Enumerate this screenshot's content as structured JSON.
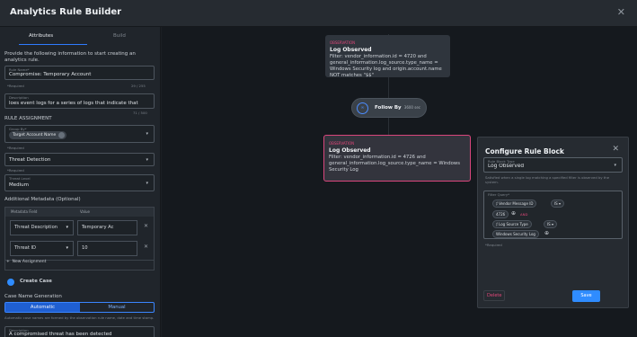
{
  "window": {
    "title": "Analytics Rule Builder"
  },
  "tabs": [
    "Attributes",
    "Build"
  ],
  "intro": "Provide the following information to start creating an analytics rule.",
  "rule_name": {
    "label": "Rule Name*",
    "value": "Compromise: Temporary Account",
    "help": "*Required",
    "count": "29 / 255"
  },
  "description": {
    "label": "Description",
    "value": "loes event logs for a series of logs that indicate that",
    "count": "71 / 500"
  },
  "rule_assignment": {
    "heading": "RULE ASSIGNMENT",
    "group_by": {
      "label": "Group By*",
      "chip": "Target Account Name",
      "help": "*Required"
    },
    "category": {
      "value": "Threat Detection",
      "help": "*Required"
    },
    "threat_level": {
      "label": "Threat Level",
      "value": "Medium"
    }
  },
  "metadata": {
    "heading": "Additional Metadata (Optional)",
    "columns": [
      "Metadata Field",
      "Value"
    ],
    "rows": [
      {
        "field": "Threat Description",
        "value": "Temporary Ac"
      },
      {
        "field": "Threat ID",
        "value": "10"
      }
    ],
    "new_label": "New Assignment"
  },
  "create_case": "Create Case",
  "case_name": {
    "heading": "Case Name Generation",
    "options": [
      "Automatic",
      "Manual"
    ],
    "selected": "Automatic",
    "help": "Automatic case names are formed by the observation rule name, date and time stamp.",
    "desc_label": "Description",
    "desc_value": "A compromised threat has been detected"
  },
  "canvas": {
    "node1": {
      "type": "OBSERVATION",
      "name": "Log Observed",
      "filter": "Filter: vendor_information.id = 4720 and general_information.log_source.type_name = Windows Security log and origin.account.name NOT matches \"$$\""
    },
    "follow": {
      "label": "Follow By",
      "time": "3600 sec"
    },
    "node2": {
      "type": "OBSERVATION",
      "name": "Log Observed",
      "filter": "Filter: vendor_information.id = 4726 and general_information.log_source.type_name = Windows Security Log"
    }
  },
  "configure": {
    "title": "Configure Rule Block",
    "type_label": "Rule Block Type",
    "type_value": "Log Observed",
    "type_help": "Satisfied when a single log matching a specified filter is observed by the system.",
    "filter_label": "Filter Query*",
    "q1": "Vendor Message ID",
    "op": "IS",
    "v1": "4726",
    "add": "AND",
    "q2": "Log Source Type",
    "v2": "Windows Security Log",
    "required": "*Required",
    "delete": "Delete",
    "save": "Save"
  },
  "colors": {
    "accent": "#2f8cff",
    "observation": "#e2477a",
    "selected_border": "#d9467c"
  }
}
